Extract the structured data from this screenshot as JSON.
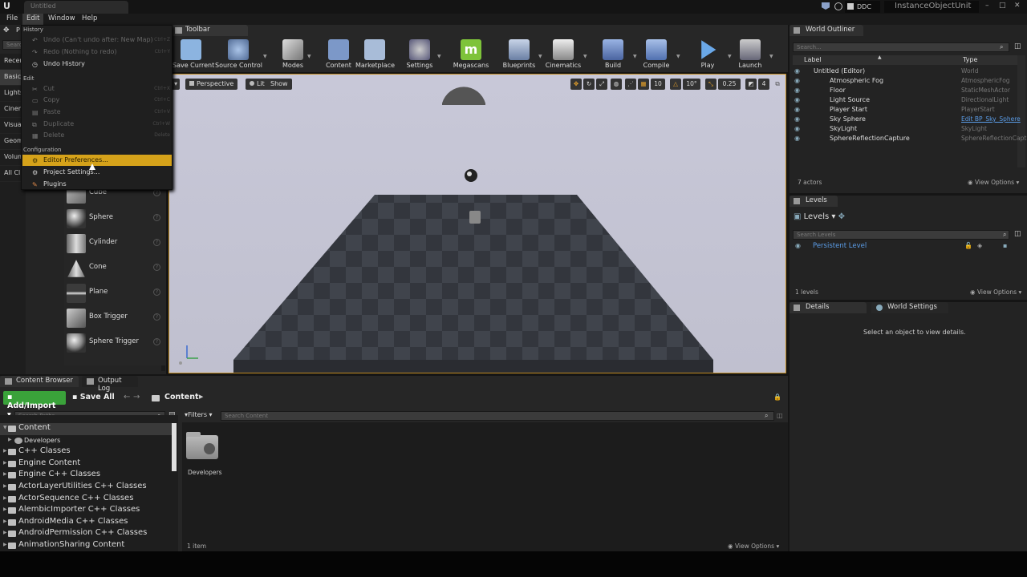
{
  "titlebar": {
    "logo": "U",
    "doc_tab": "Untitled",
    "ddc": "DDC",
    "project": "InstanceObjectUnit",
    "min": "–",
    "max": "□",
    "close": "✕"
  },
  "menu": [
    "File",
    "Edit",
    "Window",
    "Help"
  ],
  "modes": {
    "tab_p": "P",
    "search_placeholder": "Search",
    "categories": [
      "Recen",
      "Basic",
      "Lights",
      "Cinem",
      "Visual",
      "Geom",
      "Volum",
      "All Cl"
    ],
    "items": [
      "Cube",
      "Sphere",
      "Cylinder",
      "Cone",
      "Plane",
      "Box Trigger",
      "Sphere Trigger"
    ]
  },
  "edit_menu": {
    "sections": {
      "history": "History",
      "edit": "Edit",
      "configuration": "Configuration"
    },
    "history_items": [
      {
        "label": "Undo (Can't undo after: New Map)",
        "shortcut": "Ctrl+Z",
        "enabled": false
      },
      {
        "label": "Redo (Nothing to redo)",
        "shortcut": "Ctrl+Y",
        "enabled": false
      },
      {
        "label": "Undo History",
        "shortcut": "",
        "enabled": true
      }
    ],
    "edit_items": [
      {
        "label": "Cut",
        "shortcut": "Ctrl+X"
      },
      {
        "label": "Copy",
        "shortcut": "Ctrl+C"
      },
      {
        "label": "Paste",
        "shortcut": "Ctrl+V"
      },
      {
        "label": "Duplicate",
        "shortcut": "Ctrl+W"
      },
      {
        "label": "Delete",
        "shortcut": "Delete"
      }
    ],
    "config_items": [
      "Editor Preferences...",
      "Project Settings...",
      "Plugins"
    ]
  },
  "toolbar": {
    "tab": "Toolbar",
    "buttons": [
      "Save Current",
      "Source Control",
      "Modes",
      "Content",
      "Marketplace",
      "Settings",
      "Megascans",
      "Blueprints",
      "Cinematics",
      "Build",
      "Compile",
      "Play",
      "Launch"
    ],
    "colors": {
      "save": "#6fa0d8",
      "megascans": "#7ec33a",
      "play": "#5a9ad8",
      "build": "#6c8ed0"
    }
  },
  "viewport": {
    "perspective": "Perspective",
    "lit": "Lit",
    "show": "Show",
    "grid_snap": "10",
    "rot_snap": "10°",
    "scale_snap": "0.25",
    "cam_speed": "4",
    "accent": "#e8a22a"
  },
  "outliner": {
    "tab": "World Outliner",
    "search_placeholder": "Search...",
    "col_label": "Label",
    "col_type": "Type",
    "rows": [
      {
        "name": "Untitled (Editor)",
        "type": "World"
      },
      {
        "name": "Atmospheric Fog",
        "type": "AtmosphericFog"
      },
      {
        "name": "Floor",
        "type": "StaticMeshActor"
      },
      {
        "name": "Light Source",
        "type": "DirectionalLight"
      },
      {
        "name": "Player Start",
        "type": "PlayerStart"
      },
      {
        "name": "Sky Sphere",
        "type": "Edit BP_Sky_Sphere"
      },
      {
        "name": "SkyLight",
        "type": "SkyLight"
      },
      {
        "name": "SphereReflectionCapture",
        "type": "SphereReflectionCapt"
      }
    ],
    "count": "7 actors",
    "view_options": "View Options"
  },
  "levels": {
    "tab": "Levels",
    "header": "Levels",
    "search_placeholder": "Search Levels",
    "persistent": "Persistent Level",
    "count": "1 levels",
    "view_options": "View Options"
  },
  "details": {
    "tab": "Details",
    "tab2": "World Settings",
    "message": "Select an object to view details."
  },
  "content_browser": {
    "tab": "Content Browser",
    "tab2": "Output Log",
    "add_import": "Add/Import",
    "save_all": "Save All",
    "path": "Content",
    "search_paths": "Search Paths",
    "filters": "Filters",
    "search_content": "Search Content",
    "tree": [
      {
        "label": "Content",
        "level": 0,
        "selected": true
      },
      {
        "label": "Developers",
        "level": 1
      },
      {
        "label": "C++ Classes",
        "level": 0
      },
      {
        "label": "Engine Content",
        "level": 0
      },
      {
        "label": "Engine C++ Classes",
        "level": 0
      },
      {
        "label": "ActorLayerUtilities C++ Classes",
        "level": 0
      },
      {
        "label": "ActorSequence C++ Classes",
        "level": 0
      },
      {
        "label": "AlembicImporter C++ Classes",
        "level": 0
      },
      {
        "label": "AndroidMedia C++ Classes",
        "level": 0
      },
      {
        "label": "AndroidPermission C++ Classes",
        "level": 0
      },
      {
        "label": "AnimationSharing Content",
        "level": 0
      }
    ],
    "asset": "Developers",
    "item_count": "1 item",
    "view_options": "View Options"
  }
}
